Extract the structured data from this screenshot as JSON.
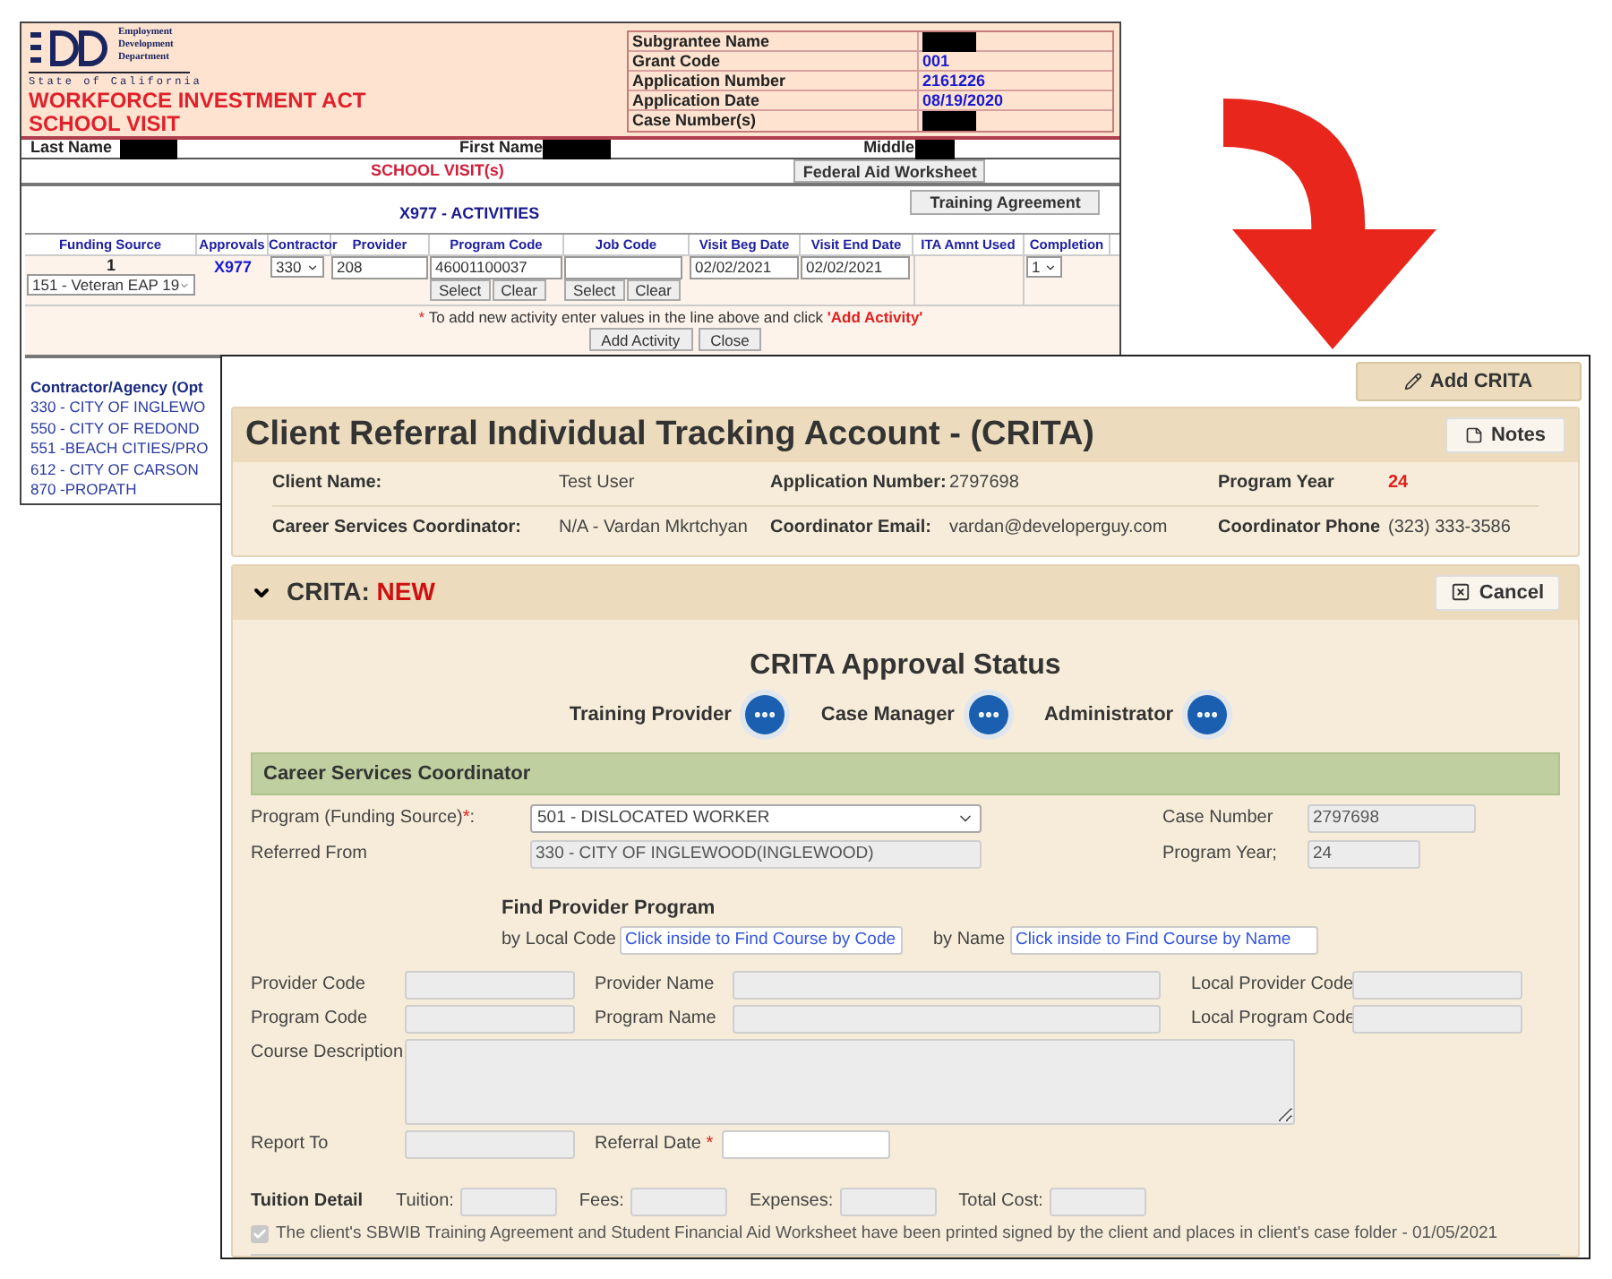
{
  "old_window": {
    "logo_text": [
      "Employment",
      "Development",
      "Department"
    ],
    "state": "State of California",
    "title_lines": [
      "WORKFORCE INVESTMENT ACT",
      "SCHOOL VISIT"
    ],
    "info": [
      {
        "label": "Subgrantee Name",
        "redacted": true
      },
      {
        "label": "Grant Code",
        "value": "001",
        "redacted": false
      },
      {
        "label": "Application Number",
        "value": "2161226",
        "redacted": false
      },
      {
        "label": "Application Date",
        "value": "08/19/2020",
        "redacted": false
      },
      {
        "label": "Case Number(s)",
        "redacted": true
      }
    ],
    "name_fields": [
      {
        "label": "Last Name",
        "redacted": true
      },
      {
        "label": "First Name",
        "redacted": true
      },
      {
        "label": "Middle",
        "redacted": true
      }
    ],
    "section_title": "SCHOOL VISIT(s)",
    "federal_button": "Federal Aid Worksheet",
    "activities_title": "X977 - ACTIVITIES",
    "training_button": "Training Agreement",
    "columns": [
      "Funding Source",
      "Approvals",
      "Contractor",
      "Provider",
      "Program Code",
      "Job Code",
      "Visit Beg Date",
      "Visit End Date",
      "ITA Amnt Used",
      "Completion"
    ],
    "activity": {
      "number": "1",
      "funding_source": "151 - Veteran EAP 19",
      "approval": "X977",
      "contractor": "330",
      "provider": "208",
      "program_code": "46001100037",
      "visit_beg": "02/02/2021",
      "visit_end": "02/02/2021",
      "completion": "1"
    },
    "program_code_buttons": [
      "Select",
      "Clear"
    ],
    "job_code_buttons": [
      "Select",
      "Clear"
    ],
    "note": {
      "mark": "*",
      "text": "To add new activity enter values in the line above and click",
      "link": "'Add Activity'"
    },
    "buttons": [
      "Add Activity",
      "Close"
    ],
    "contractor_header": "Contractor/Agency (Opt",
    "contractors": [
      "330 - CITY OF INGLEWO",
      "550 - CITY OF REDOND",
      "551 -BEACH CITIES/PRO",
      "612 - CITY OF CARSON",
      "870 -PROPATH"
    ]
  },
  "new_window": {
    "add_button": "Add CRITA",
    "title": "Client Referral Individual Tracking Account - (CRITA)",
    "notes_button": "Notes",
    "info_rows": [
      [
        {
          "label": "Client Name:",
          "value": "Test User",
          "highlight": false
        },
        {
          "label": "Application Number:",
          "value": "2797698",
          "highlight": false
        },
        {
          "label": "Program Year",
          "value": "24",
          "highlight": true
        }
      ],
      [
        {
          "label": "Career Services Coordinator:",
          "value": "N/A - Vardan Mkrtchyan",
          "highlight": false
        },
        {
          "label": "Coordinator Email:",
          "value": "vardan@developerguy.com",
          "highlight": false
        },
        {
          "label": "Coordinator Phone",
          "value": "(323) 333-3586",
          "highlight": false
        }
      ]
    ],
    "crita": {
      "expanded": true,
      "label": "CRITA:",
      "status": "NEW",
      "cancel_button": "Cancel"
    },
    "approval": {
      "title": "CRITA Approval Status",
      "steps": [
        "Training Provider",
        "Case Manager",
        "Administrator"
      ]
    },
    "section_title": "Career Services Coordinator",
    "program": {
      "label": "Program (Funding Source)",
      "required_mark": "*",
      "suffix": ":",
      "value": "501 - DISLOCATED WORKER"
    },
    "case_number": {
      "label": "Case Number",
      "value": "2797698",
      "disabled": true
    },
    "referred_from": {
      "label": "Referred From",
      "value": "330 - CITY OF INGLEWOOD(INGLEWOOD)",
      "disabled": true
    },
    "program_year": {
      "label": "Program Year;",
      "value": "24",
      "disabled": true
    },
    "find_provider": {
      "title": "Find Provider Program",
      "by_code": {
        "label": "by Local Code",
        "placeholder": "Click inside to Find Course by Code"
      },
      "by_name": {
        "label": "by Name",
        "placeholder": "Click inside to Find Course by Name"
      }
    },
    "provider_rows": [
      [
        {
          "label": "Provider Code",
          "disabled": true
        },
        {
          "label": "Provider Name",
          "disabled": true
        },
        {
          "label": "Local Provider Code",
          "disabled": true
        }
      ],
      [
        {
          "label": "Program Code",
          "disabled": true
        },
        {
          "label": "Program Name",
          "disabled": true
        },
        {
          "label": "Local Program Code",
          "disabled": true
        }
      ]
    ],
    "course_description": {
      "label": "Course Description",
      "disabled": true
    },
    "report_to": {
      "label": "Report To",
      "disabled": true
    },
    "referral_date": {
      "label": "Referral Date",
      "required_mark": "*",
      "disabled": false
    },
    "tuition": {
      "title": "Tuition Detail",
      "fields": [
        {
          "label": "Tuition:",
          "disabled": true
        },
        {
          "label": "Fees:",
          "disabled": true
        },
        {
          "label": "Expenses:",
          "disabled": true
        },
        {
          "label": "Total Cost:",
          "disabled": true
        }
      ]
    },
    "acknowledgement": {
      "checked": true,
      "disabled": true,
      "text": "The client's SBWIB Training Agreement and Student Financial Aid Worksheet have been printed signed by the client and places in client's case folder - 01/05/2021"
    }
  }
}
